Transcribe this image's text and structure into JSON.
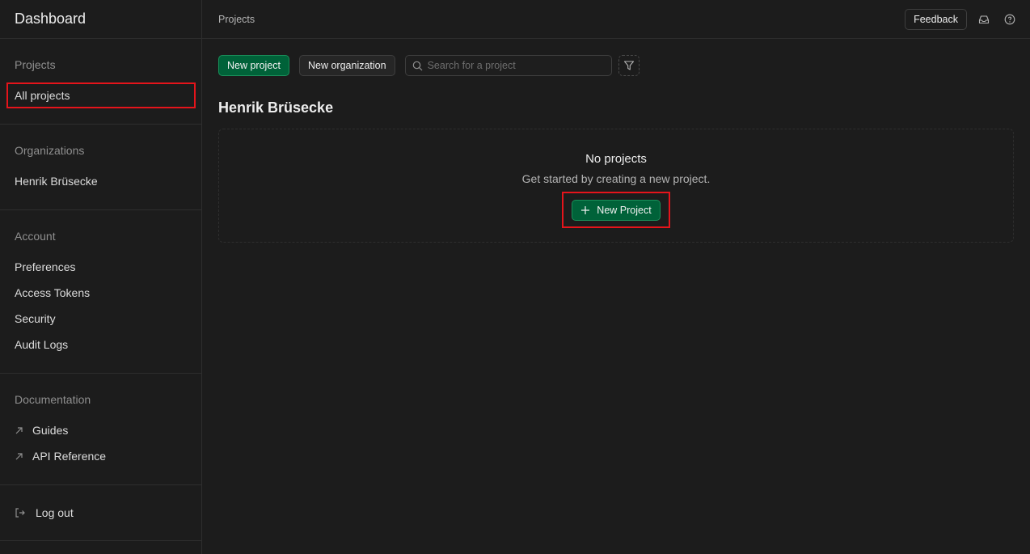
{
  "sidebar": {
    "title": "Dashboard",
    "projects": {
      "title": "Projects",
      "items": [
        "All projects"
      ]
    },
    "organizations": {
      "title": "Organizations",
      "items": [
        "Henrik Brüsecke"
      ]
    },
    "account": {
      "title": "Account",
      "items": [
        "Preferences",
        "Access Tokens",
        "Security",
        "Audit Logs"
      ]
    },
    "documentation": {
      "title": "Documentation",
      "items": [
        "Guides",
        "API Reference"
      ]
    },
    "logout": "Log out"
  },
  "topbar": {
    "breadcrumb": "Projects",
    "feedback": "Feedback"
  },
  "toolbar": {
    "new_project": "New project",
    "new_organization": "New organization",
    "search_placeholder": "Search for a project"
  },
  "org": {
    "name": "Henrik Brüsecke",
    "empty_title": "No projects",
    "empty_subtitle": "Get started by creating a new project.",
    "new_project_button": "New Project"
  },
  "colors": {
    "background": "#1c1c1c",
    "brand_green": "#006239",
    "highlight_red": "#e5141b"
  }
}
